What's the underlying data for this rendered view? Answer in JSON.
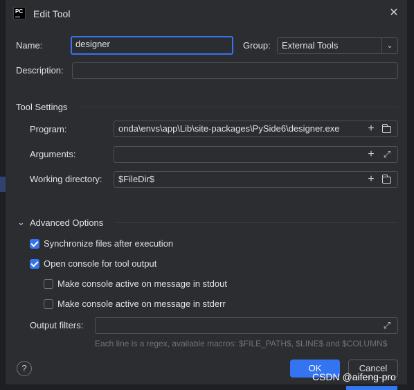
{
  "dialog": {
    "app_icon_text": "PC",
    "title": "Edit Tool",
    "close_glyph": "✕"
  },
  "form": {
    "name_label": "Name:",
    "name_value": "designer",
    "group_label": "Group:",
    "group_value": "External Tools",
    "description_label": "Description:",
    "description_value": ""
  },
  "tool_settings": {
    "title": "Tool Settings",
    "program_label": "Program:",
    "program_value": "onda\\envs\\app\\Lib\\site-packages\\PySide6\\designer.exe",
    "arguments_label": "Arguments:",
    "arguments_value": "",
    "working_dir_label": "Working directory:",
    "working_dir_value": "$FileDir$"
  },
  "advanced": {
    "title": "Advanced Options",
    "options": [
      {
        "label": "Synchronize files after execution",
        "checked": true
      },
      {
        "label": "Open console for tool output",
        "checked": true
      },
      {
        "label": "Make console active on message in stdout",
        "checked": false
      },
      {
        "label": "Make console active on message in stderr",
        "checked": false
      }
    ],
    "output_filters_label": "Output filters:",
    "output_filters_value": "",
    "hint": "Each line is a regex, available macros: $FILE_PATH$, $LINE$ and $COLUMN$"
  },
  "footer": {
    "help_glyph": "?",
    "ok_label": "OK",
    "cancel_label": "Cancel",
    "watermark": "CSDN @aifeng-pro"
  },
  "icons": {
    "plus": "+",
    "expand": "⤢",
    "chevron_down": "⌄",
    "collapse": "⌄"
  },
  "colors": {
    "background": "#2b2d30",
    "accent": "#3574f0",
    "text": "#dfe1e5",
    "hint": "#6f737a"
  }
}
